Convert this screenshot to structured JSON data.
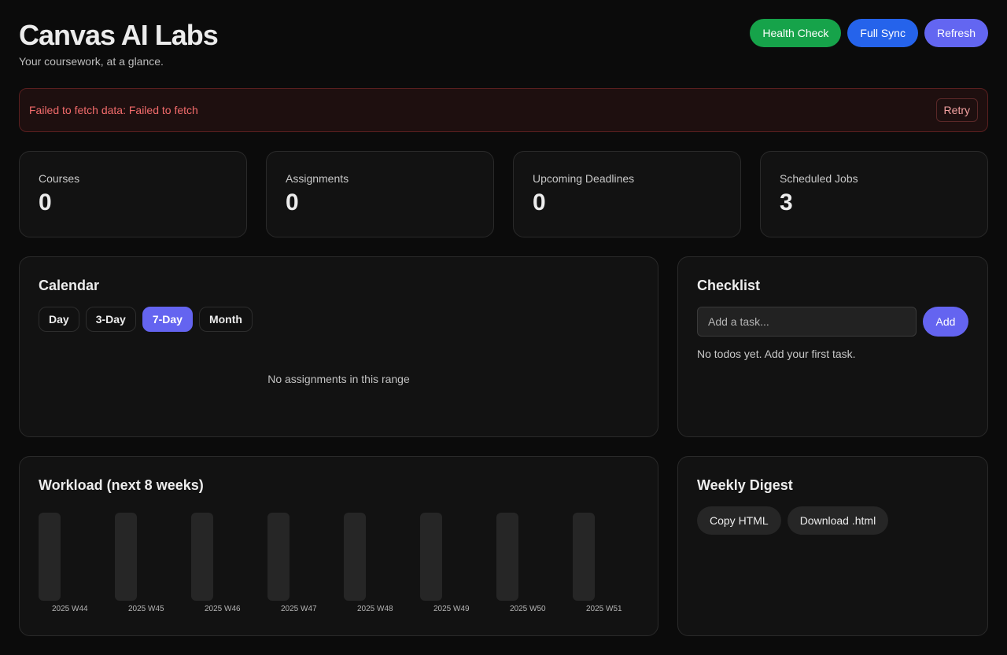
{
  "header": {
    "title": "Canvas AI Labs",
    "subtitle": "Your coursework, at a glance."
  },
  "actions": {
    "health_check": "Health Check",
    "full_sync": "Full Sync",
    "refresh": "Refresh"
  },
  "colors": {
    "health_check": "#16a34a",
    "full_sync": "#2563eb",
    "refresh": "#6366f1",
    "accent": "#6464f0",
    "error_text": "#f26b6b"
  },
  "error": {
    "message": "Failed to fetch data: Failed to fetch",
    "retry_label": "Retry"
  },
  "stats": [
    {
      "label": "Courses",
      "value": "0"
    },
    {
      "label": "Assignments",
      "value": "0"
    },
    {
      "label": "Upcoming Deadlines",
      "value": "0"
    },
    {
      "label": "Scheduled Jobs",
      "value": "3"
    }
  ],
  "calendar": {
    "title": "Calendar",
    "views": [
      "Day",
      "3-Day",
      "7-Day",
      "Month"
    ],
    "active_view": "7-Day",
    "empty_text": "No assignments in this range"
  },
  "checklist": {
    "title": "Checklist",
    "placeholder": "Add a task...",
    "add_label": "Add",
    "empty_text": "No todos yet. Add your first task."
  },
  "workload": {
    "title": "Workload (next 8 weeks)",
    "weeks": [
      "2025 W44",
      "2025 W45",
      "2025 W46",
      "2025 W47",
      "2025 W48",
      "2025 W49",
      "2025 W50",
      "2025 W51"
    ]
  },
  "digest": {
    "title": "Weekly Digest",
    "copy_label": "Copy HTML",
    "download_label": "Download .html"
  }
}
